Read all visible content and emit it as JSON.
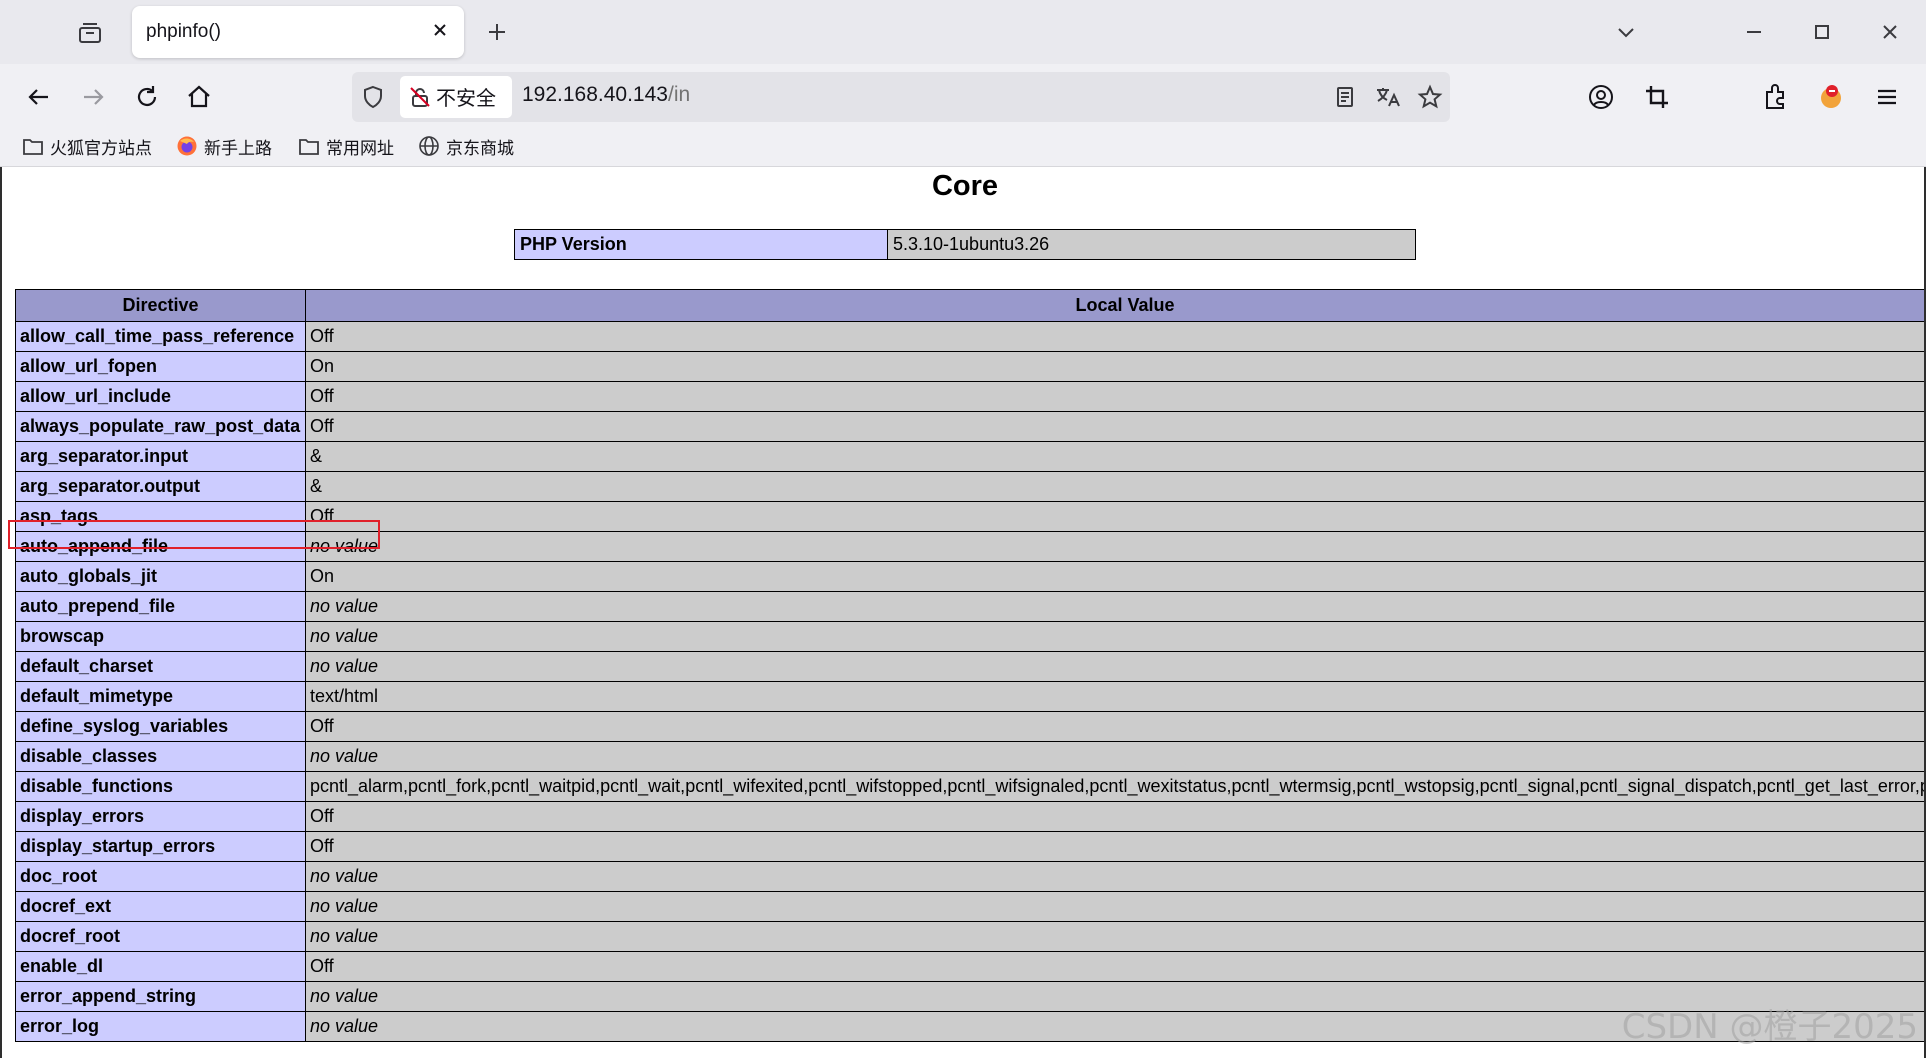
{
  "browser": {
    "tab_title": "phpinfo()",
    "security_label": "不安全",
    "url_host": "192.168.40.143",
    "url_path": "/in",
    "bookmarks": [
      {
        "label": "火狐官方站点",
        "icon": "folder-icon"
      },
      {
        "label": "新手上路",
        "icon": "firefox-icon"
      },
      {
        "label": "常用网址",
        "icon": "folder-icon"
      },
      {
        "label": "京东商城",
        "icon": "globe-icon"
      }
    ]
  },
  "page": {
    "section_title": "Core",
    "php_version_label": "PHP Version",
    "php_version_value": "5.3.10-1ubuntu3.26",
    "table_headers": {
      "directive": "Directive",
      "local_value": "Local Value"
    },
    "rows": [
      {
        "k": "allow_call_time_pass_reference",
        "v": "Off"
      },
      {
        "k": "allow_url_fopen",
        "v": "On"
      },
      {
        "k": "allow_url_include",
        "v": "Off"
      },
      {
        "k": "always_populate_raw_post_data",
        "v": "Off"
      },
      {
        "k": "arg_separator.input",
        "v": "&"
      },
      {
        "k": "arg_separator.output",
        "v": "&"
      },
      {
        "k": "asp_tags",
        "v": "Off"
      },
      {
        "k": "auto_append_file",
        "v": "no value"
      },
      {
        "k": "auto_globals_jit",
        "v": "On"
      },
      {
        "k": "auto_prepend_file",
        "v": "no value"
      },
      {
        "k": "browscap",
        "v": "no value"
      },
      {
        "k": "default_charset",
        "v": "no value"
      },
      {
        "k": "default_mimetype",
        "v": "text/html"
      },
      {
        "k": "define_syslog_variables",
        "v": "Off"
      },
      {
        "k": "disable_classes",
        "v": "no value"
      },
      {
        "k": "disable_functions",
        "v": "pcntl_alarm,pcntl_fork,pcntl_waitpid,pcntl_wait,pcntl_wifexited,pcntl_wifstopped,pcntl_wifsignaled,pcntl_wexitstatus,pcntl_wtermsig,pcntl_wstopsig,pcntl_signal,pcntl_signal_dispatch,pcntl_get_last_error,p"
      },
      {
        "k": "display_errors",
        "v": "Off"
      },
      {
        "k": "display_startup_errors",
        "v": "Off"
      },
      {
        "k": "doc_root",
        "v": "no value"
      },
      {
        "k": "docref_ext",
        "v": "no value"
      },
      {
        "k": "docref_root",
        "v": "no value"
      },
      {
        "k": "enable_dl",
        "v": "Off"
      },
      {
        "k": "error_append_string",
        "v": "no value"
      },
      {
        "k": "error_log",
        "v": "no value"
      }
    ]
  },
  "watermark": "CSDN @橙子2025",
  "colors": {
    "directive_bg": "#ccccff",
    "value_bg": "#cccccc",
    "header_bg": "#9999cc",
    "highlight": "#e0202a"
  }
}
